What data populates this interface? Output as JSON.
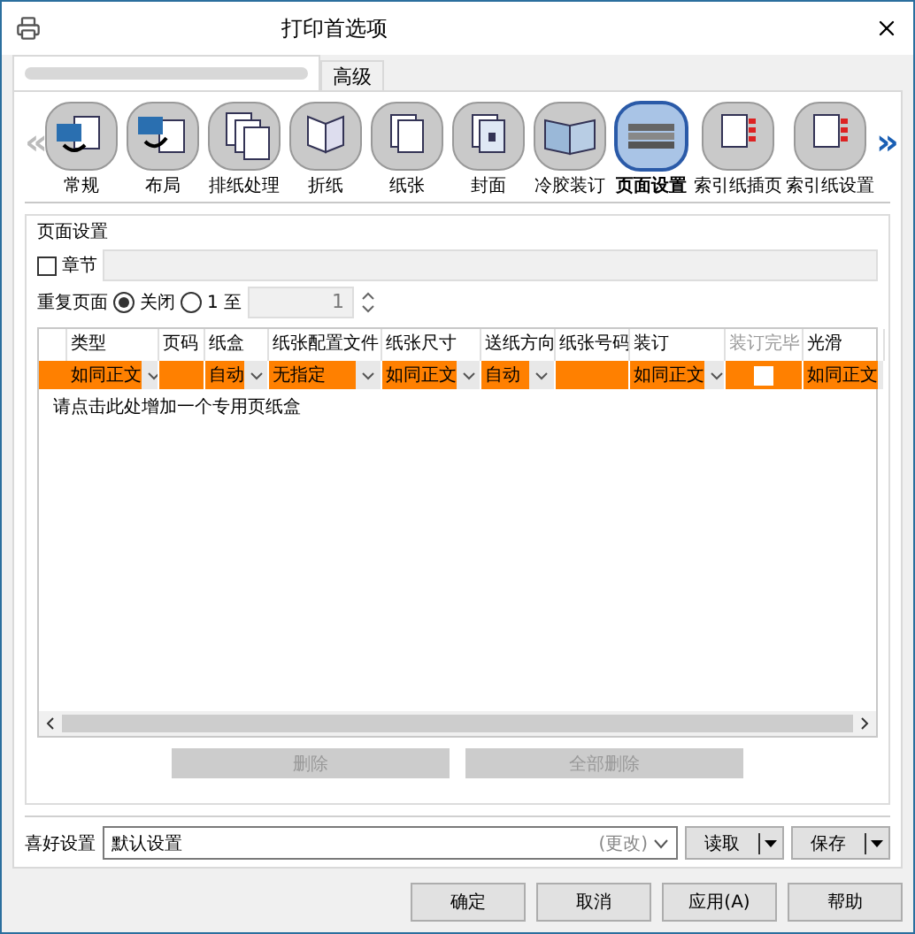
{
  "window": {
    "title": "打印首选项"
  },
  "tabs": [
    {
      "kind": "redacted",
      "selected": true
    },
    {
      "kind": "text",
      "label": "高级",
      "selected": false
    }
  ],
  "feature_nav": {
    "prev": "«",
    "next": "»"
  },
  "features": [
    {
      "kind": "general",
      "label": "常规",
      "selected": false
    },
    {
      "kind": "layout",
      "label": "布局",
      "selected": false
    },
    {
      "kind": "finishing",
      "label": "排纸处理",
      "selected": false
    },
    {
      "kind": "fold",
      "label": "折纸",
      "selected": false
    },
    {
      "kind": "paper",
      "label": "纸张",
      "selected": false
    },
    {
      "kind": "cover",
      "label": "封面",
      "selected": false
    },
    {
      "kind": "binding",
      "label": "冷胶装订",
      "selected": false
    },
    {
      "kind": "stack",
      "label": "页面设置",
      "selected": true
    },
    {
      "kind": "tabs",
      "label": "索引纸插页",
      "selected": false
    },
    {
      "kind": "tabs",
      "label": "索引纸设置",
      "selected": false
    }
  ],
  "page_setup": {
    "title": "页面设置",
    "chapter": {
      "label": "章节",
      "checked": false
    },
    "repeat": {
      "label": "重复页面",
      "options": [
        {
          "label": "关闭",
          "selected": true
        },
        {
          "label": "1 至",
          "selected": false
        }
      ],
      "value": "1"
    },
    "table": {
      "columns": [
        {
          "label": "类型",
          "disabled": false
        },
        {
          "label": "页码",
          "disabled": false
        },
        {
          "label": "纸盒",
          "disabled": false
        },
        {
          "label": "纸张配置文件",
          "disabled": false
        },
        {
          "label": "纸张尺寸",
          "disabled": false
        },
        {
          "label": "送纸方向",
          "disabled": false
        },
        {
          "label": "纸张号码",
          "disabled": false
        },
        {
          "label": "装订",
          "disabled": false
        },
        {
          "label": "装订完毕",
          "disabled": true
        },
        {
          "label": "光滑",
          "disabled": false
        }
      ],
      "rows": [
        {
          "cells": [
            {
              "kind": "dropdown",
              "text": "如同正文"
            },
            {
              "kind": "blank"
            },
            {
              "kind": "dropdown",
              "text": "自动"
            },
            {
              "kind": "dropdown",
              "text": "无指定"
            },
            {
              "kind": "dropdown",
              "text": "如同正文"
            },
            {
              "kind": "dropdown",
              "text": "自动"
            },
            {
              "kind": "blank"
            },
            {
              "kind": "dropdown",
              "text": "如同正文"
            },
            {
              "kind": "checkbox",
              "checked": false
            },
            {
              "kind": "dropdown",
              "text": "如同正文"
            }
          ]
        }
      ],
      "hint": "请点击此处增加一个专用页纸盒"
    },
    "buttons": [
      {
        "label": "删除",
        "disabled": true
      },
      {
        "label": "全部删除",
        "disabled": true
      }
    ]
  },
  "favorites": {
    "label": "喜好设置",
    "value": "默认设置",
    "suffix": "(更改)",
    "buttons": [
      "读取",
      "保存"
    ]
  },
  "footer_buttons": [
    "确定",
    "取消",
    "应用(A)",
    "帮助"
  ]
}
